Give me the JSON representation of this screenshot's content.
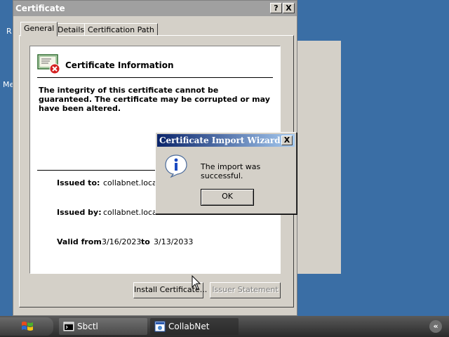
{
  "desktop": {
    "label_r": "R",
    "label_me": "Me"
  },
  "certificate": {
    "title": "Certificate",
    "help_glyph": "?",
    "close_glyph": "X",
    "tabs": [
      {
        "label": "General",
        "active": true
      },
      {
        "label": "Details",
        "active": false
      },
      {
        "label": "Certification Path",
        "active": false
      }
    ],
    "info_heading": "Certificate Information",
    "warning": "The integrity of this certificate cannot be guaranteed. The certificate may be corrupted or may have been altered.",
    "issued_to_label": "Issued to:",
    "issued_to_value": "collabnet.local",
    "issued_by_label": "Issued by:",
    "issued_by_value": "collabnet.local",
    "valid_from_label": "Valid from",
    "valid_from": "3/16/2023",
    "to_label": "to",
    "valid_to": "3/13/2033",
    "install_button": "Install Certificate...",
    "issuer_button": "Issuer Statement"
  },
  "wizard": {
    "title": "Certificate Import Wizard",
    "close_glyph": "X",
    "message": "The import was successful.",
    "ok_label": "OK",
    "icon": "information-icon"
  },
  "taskbar": {
    "items": [
      {
        "label": "Sbctl",
        "active": false,
        "icon": "terminal-icon"
      },
      {
        "label": "CollabNet",
        "active": true,
        "icon": "browser-icon"
      }
    ],
    "tray_glyph": "«"
  },
  "colors": {
    "desktop": "#3a6ea5",
    "dialog_face": "#d4d0c8",
    "active_title_start": "#0a246a",
    "active_title_end": "#a6caf0",
    "inactive_title": "#a0a0a0"
  }
}
